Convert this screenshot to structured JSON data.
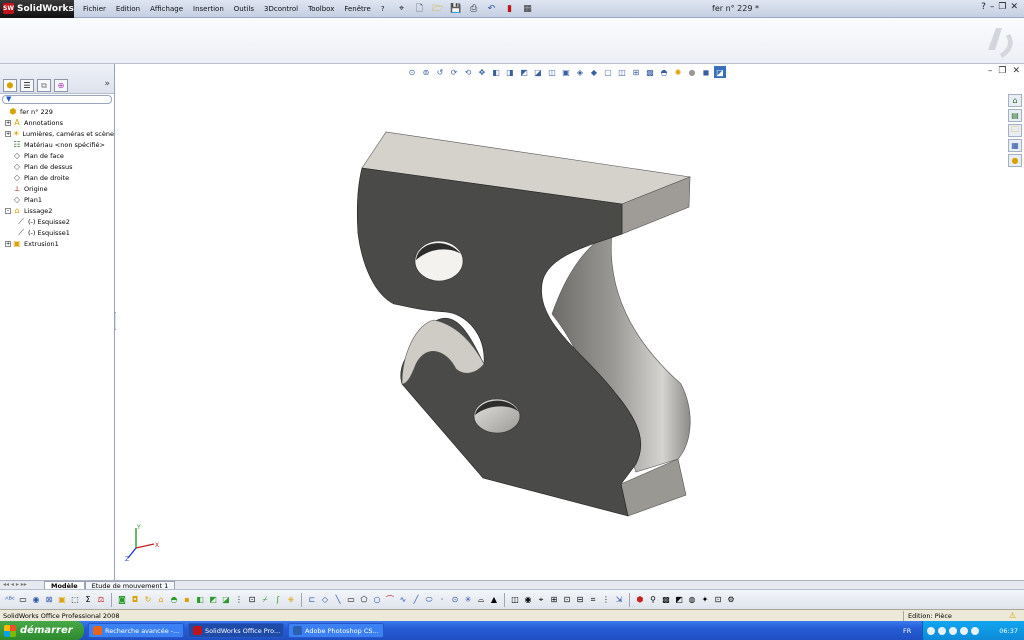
{
  "titlebar": {
    "app_name": "SolidWorks",
    "app_badge": "SW",
    "menus": [
      "Fichier",
      "Edition",
      "Affichage",
      "Insertion",
      "Outils",
      "3Dcontrol",
      "Toolbox",
      "Fenêtre",
      "?"
    ],
    "document_title": "fer n° 229 *",
    "help": "?",
    "minimize": "–",
    "restore": "❐",
    "close": "✕"
  },
  "feature_tree": {
    "filter_icon": "filter-icon",
    "items": [
      {
        "label": "fer n° 229",
        "icon": "part-icon",
        "expand": ""
      },
      {
        "label": "Annotations",
        "icon": "annotations-icon",
        "expand": "+"
      },
      {
        "label": "Lumières, caméras et scène",
        "icon": "lights-icon",
        "expand": "+"
      },
      {
        "label": "Matériau <non spécifié>",
        "icon": "material-icon",
        "expand": ""
      },
      {
        "label": "Plan de face",
        "icon": "plane-icon",
        "expand": ""
      },
      {
        "label": "Plan de dessus",
        "icon": "plane-icon",
        "expand": ""
      },
      {
        "label": "Plan de droite",
        "icon": "plane-icon",
        "expand": ""
      },
      {
        "label": "Origine",
        "icon": "origin-icon",
        "expand": ""
      },
      {
        "label": "Plan1",
        "icon": "plane-icon",
        "expand": ""
      },
      {
        "label": "Lissage2",
        "icon": "loft-icon",
        "expand": "–"
      },
      {
        "label": "(-) Esquisse2",
        "icon": "sketch-icon",
        "expand": ""
      },
      {
        "label": "(-) Esquisse1",
        "icon": "sketch-icon",
        "expand": ""
      },
      {
        "label": "Extrusion1",
        "icon": "extrude-icon",
        "expand": "+"
      }
    ]
  },
  "model_tabs": [
    "Modèle",
    "Etude de mouvement 1"
  ],
  "statusbar": {
    "product": "SolidWorks Office Professional 2008",
    "mode": "Edition: Pièce"
  },
  "taskbar": {
    "start_label": "démarrer",
    "tasks": [
      {
        "label": "Recherche avancée -...",
        "color": "#e8641b"
      },
      {
        "label": "SolidWorks Office Pro...",
        "color": "#c0141b"
      },
      {
        "label": "Adobe Photoshop CS...",
        "color": "#2b5fb0"
      }
    ],
    "language": "FR",
    "clock": "06:37"
  },
  "triad": {
    "x": "X",
    "y": "Y",
    "z": "Z"
  },
  "colors": {
    "part_face": "#4a4a48",
    "part_edge_light": "#d2d0cc",
    "part_side": "#a09e9a"
  }
}
